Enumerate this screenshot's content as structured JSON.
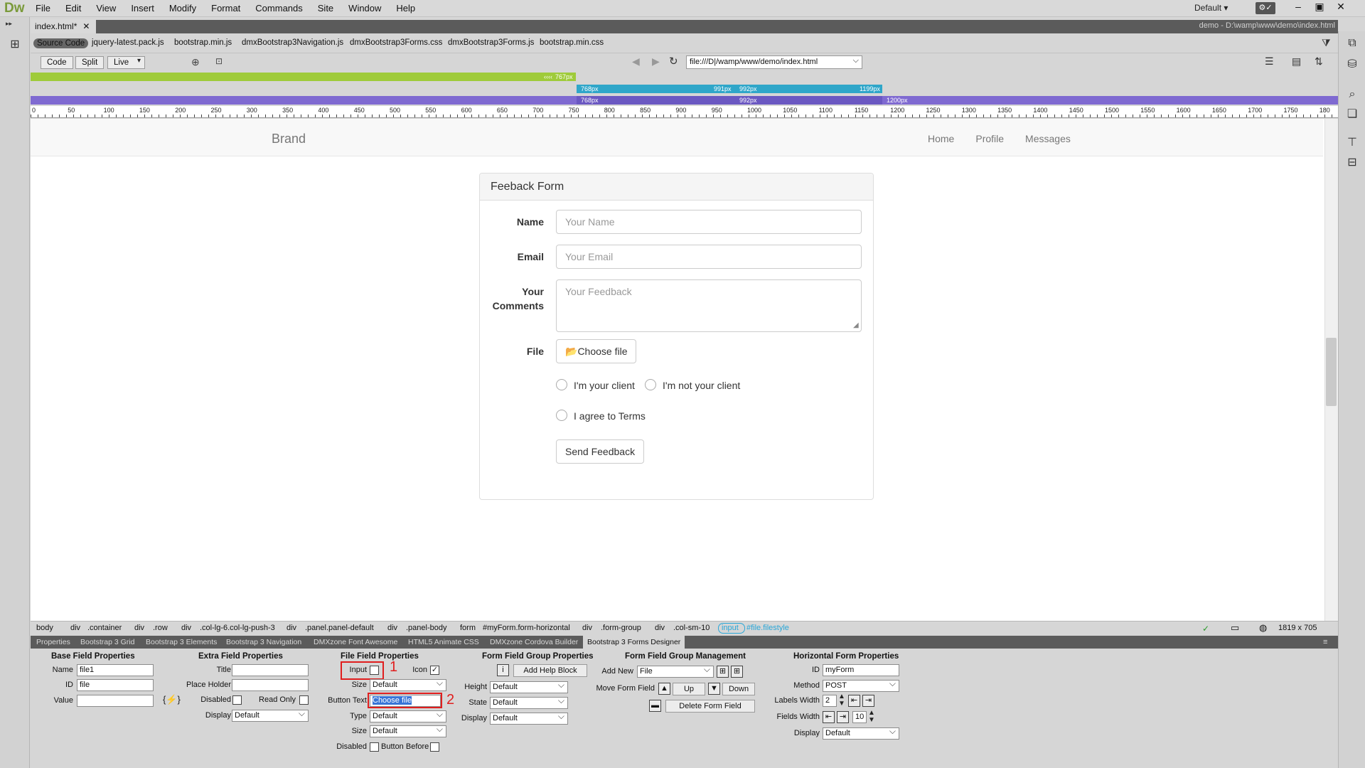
{
  "app": {
    "logo": "Dw",
    "menus": [
      "File",
      "Edit",
      "View",
      "Insert",
      "Modify",
      "Format",
      "Commands",
      "Site",
      "Window",
      "Help"
    ],
    "workspace": "Default"
  },
  "document": {
    "tab_label": "index.html*",
    "path": "demo - D:\\wamp\\www\\demo\\index.html",
    "related_files": [
      "Source Code",
      "jquery-latest.pack.js",
      "bootstrap.min.js",
      "dmxBootstrap3Navigation.js",
      "dmxBootstrap3Forms.css",
      "dmxBootstrap3Forms.js",
      "bootstrap.min.css"
    ]
  },
  "toolbar": {
    "code": "Code",
    "split": "Split",
    "live": "Live",
    "url": "file:///D|/wamp/www/demo/index.html"
  },
  "media_queries": {
    "q1": "767px",
    "q2a": "768px",
    "q2b": "991px",
    "q2c": "992px",
    "q2d": "1199px",
    "q3a": "768px",
    "q3b": "992px",
    "q3c": "1200px"
  },
  "ruler_labels": [
    "0",
    "50",
    "100",
    "150",
    "200",
    "250",
    "300",
    "350",
    "400",
    "450",
    "500",
    "550",
    "600",
    "650",
    "700",
    "750",
    "800",
    "850",
    "900",
    "950",
    "1000",
    "1050",
    "1100",
    "1150",
    "1200",
    "1250",
    "1300",
    "1350",
    "1400",
    "1450",
    "1500",
    "1550",
    "1600",
    "1650",
    "1700",
    "1750",
    "180"
  ],
  "page": {
    "brand": "Brand",
    "nav": [
      "Home",
      "Profile",
      "Messages"
    ],
    "panel_title": "Feeback Form",
    "name_label": "Name",
    "name_placeholder": "Your Name",
    "email_label": "Email",
    "email_placeholder": "Your Email",
    "comments_label_1": "Your",
    "comments_label_2": "Comments",
    "comments_placeholder": "Your Feedback",
    "file_label": "File",
    "file_button": "Choose file",
    "radio_1": "I'm your client",
    "radio_2": "I'm not your client",
    "checkbox_terms": "I agree to Terms",
    "submit": "Send Feedback"
  },
  "tag_selector": [
    "body",
    "div",
    ".container",
    "div",
    ".row",
    "div",
    ".col-lg-6.col-lg-push-3",
    "div",
    ".panel.panel-default",
    "div",
    ".panel-body",
    "form",
    "#myForm.form-horizontal",
    "div",
    ".form-group",
    "div",
    ".col-sm-10",
    "input",
    "#file.filestyle"
  ],
  "status": {
    "size": "1819 x 705"
  },
  "panel_tabs": [
    "Properties",
    "Bootstrap 3 Grid",
    "Bootstrap 3 Elements",
    "Bootstrap 3 Navigation",
    "DMXzone Font Awesome",
    "HTML5 Animate CSS",
    "DMXzone Cordova Builder",
    "Bootstrap 3 Forms Designer"
  ],
  "inspector": {
    "base": {
      "title": "Base Field Properties",
      "name_label": "Name",
      "name_value": "file1",
      "id_label": "ID",
      "id_value": "file",
      "value_label": "Value"
    },
    "extra": {
      "title": "Extra Field Properties",
      "title_label": "Title",
      "placeholder_label": "Place Holder",
      "disabled_label": "Disabled",
      "readonly_label": "Read Only",
      "display_label": "Display",
      "display_value": "Default"
    },
    "file": {
      "title": "File Field Properties",
      "input_label": "Input",
      "icon_label": "Icon",
      "size_label": "Size",
      "size_value": "Default",
      "button_text_label": "Button Text",
      "button_text_value": "Choose file",
      "type_label": "Type",
      "type_value": "Default",
      "size2_label": "Size",
      "size2_value": "Default",
      "disabled_label": "Disabled",
      "button_before_label": "Button Before",
      "marker_1": "1",
      "marker_2": "2"
    },
    "group": {
      "title": "Form Field Group Properties",
      "add_help": "Add Help Block",
      "height_label": "Height",
      "height_value": "Default",
      "state_label": "State",
      "state_value": "Default",
      "display_label": "Display",
      "display_value": "Default"
    },
    "management": {
      "title": "Form Field Group Management",
      "add_new_label": "Add New",
      "add_new_value": "File",
      "move_label": "Move Form Field",
      "up": "Up",
      "down": "Down",
      "delete": "Delete Form Field"
    },
    "horizontal": {
      "title": "Horizontal Form Properties",
      "id_label": "ID",
      "id_value": "myForm",
      "method_label": "Method",
      "method_value": "POST",
      "labels_width_label": "Labels Width",
      "labels_width_value": "2",
      "fields_width_label": "Fields Width",
      "fields_width_value": "10",
      "display_label": "Display",
      "display_value": "Default"
    }
  }
}
